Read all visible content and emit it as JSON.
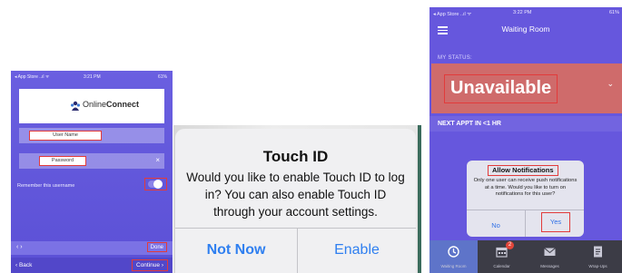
{
  "login": {
    "status_bar": {
      "carrier": "◂ App Store ..ıl ᯤ",
      "time": "3:21 PM",
      "battery": "61%"
    },
    "logo": {
      "prefix": "Online",
      "bold": "Connect"
    },
    "username_label": "User Name",
    "password_label": "Password",
    "clear_icon": "×",
    "remember_label": "Remember this username",
    "keyboard_arrows": "‹ ›",
    "done_label": "Done",
    "back_label": "‹ Back",
    "continue_label": "Continue ›",
    "colors": {
      "background": "#5b50d6",
      "highlight": "#e23b3b"
    }
  },
  "touch_id": {
    "title": "Touch ID",
    "message": "Would you like to enable Touch ID to log in? You can also enable Touch ID through your account settings.",
    "not_now_label": "Not Now",
    "enable_label": "Enable",
    "colors": {
      "button": "#2f7ff0"
    }
  },
  "waiting_room": {
    "status_bar": {
      "carrier": "◂ App Store ..ıl ᯤ",
      "time": "3:22 PM",
      "battery": "61%"
    },
    "title": "Waiting Room",
    "my_status_label": "MY STATUS:",
    "status_value": "Unavailable",
    "chevron": "⌄",
    "next_appt_label": "NEXT APPT IN <1 HR",
    "alert": {
      "title": "Allow Notifications",
      "message": "Only one user can receive push notifications at a time. Would you like to turn on notifications for this user?",
      "no_label": "No",
      "yes_label": "Yes"
    },
    "tabs": [
      {
        "label": "Waiting Room",
        "icon": "clock-icon"
      },
      {
        "label": "Calendar",
        "icon": "calendar-icon",
        "badge": "2"
      },
      {
        "label": "Messages",
        "icon": "mail-icon"
      },
      {
        "label": "Wrap-Ups",
        "icon": "notes-icon"
      }
    ],
    "colors": {
      "background": "#6657dd",
      "status_card": "#cf6b6b",
      "tabbar": "#3c3c46"
    }
  }
}
